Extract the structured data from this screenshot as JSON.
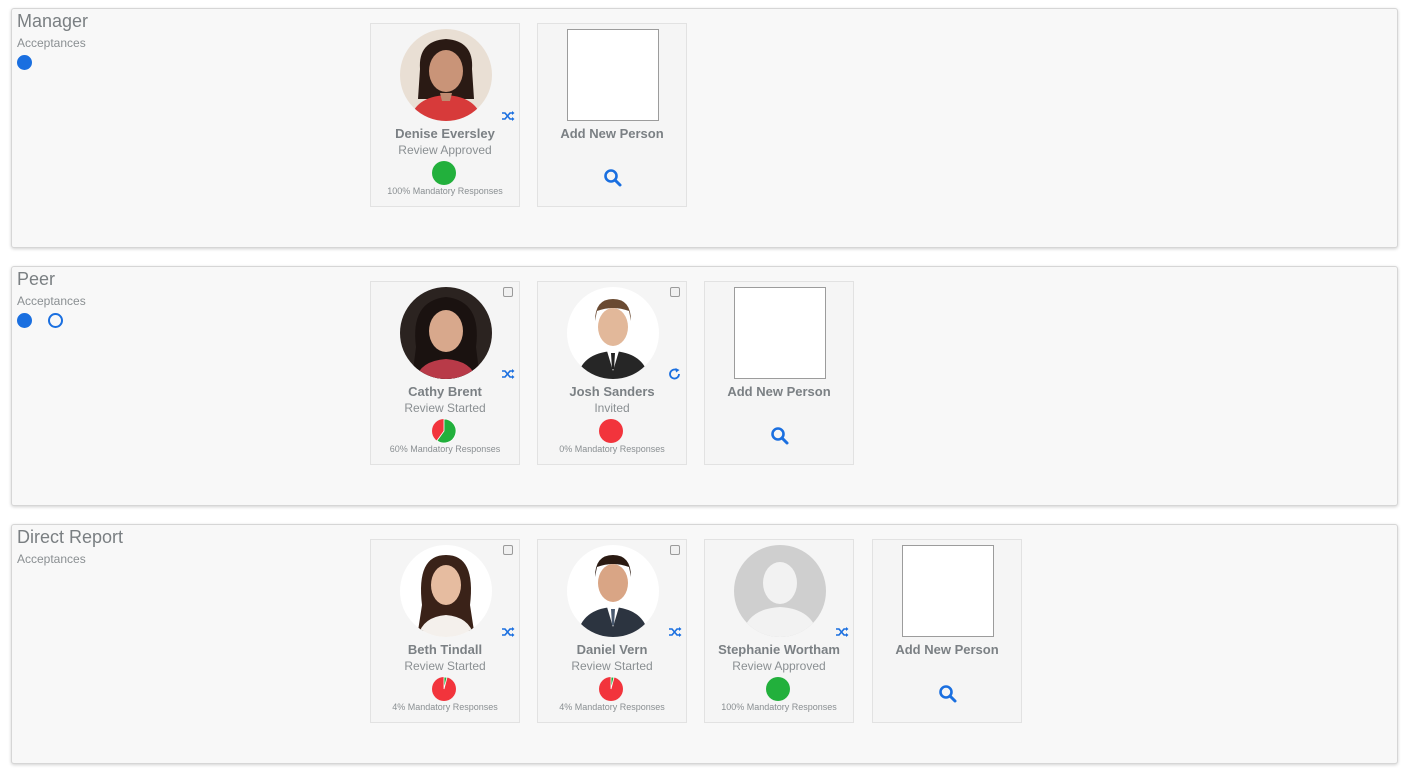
{
  "colors": {
    "accent": "#1a6fe0",
    "green": "#22b03c",
    "red": "#f2343c"
  },
  "sections": [
    {
      "title": "Manager",
      "acceptances_label": "Acceptances",
      "people": [
        {
          "name": "Denise Eversley",
          "status": "Review Approved",
          "responses": "100% Mandatory Responses",
          "progress": 1.0,
          "action_icon": "shuffle-icon",
          "checkbox": false
        }
      ],
      "add_label": "Add New Person"
    },
    {
      "title": "Peer",
      "acceptances_label": "Acceptances",
      "people": [
        {
          "name": "Cathy Brent",
          "status": "Review Started",
          "responses": "60% Mandatory Responses",
          "progress": 0.6,
          "action_icon": "shuffle-icon",
          "checkbox": true
        },
        {
          "name": "Josh Sanders",
          "status": "Invited",
          "responses": "0% Mandatory Responses",
          "progress": 0.0,
          "action_icon": "refresh-icon",
          "checkbox": true
        }
      ],
      "add_label": "Add New Person"
    },
    {
      "title": "Direct Report",
      "acceptances_label": "Acceptances",
      "people": [
        {
          "name": "Beth Tindall",
          "status": "Review Started",
          "responses": "4% Mandatory Responses",
          "progress": 0.04,
          "action_icon": "shuffle-icon",
          "checkbox": true
        },
        {
          "name": "Daniel Vern",
          "status": "Review Started",
          "responses": "4% Mandatory Responses",
          "progress": 0.04,
          "action_icon": "shuffle-icon",
          "checkbox": true
        },
        {
          "name": "Stephanie Wortham",
          "status": "Review Approved",
          "responses": "100% Mandatory Responses",
          "progress": 1.0,
          "action_icon": "shuffle-icon",
          "checkbox": false
        }
      ],
      "add_label": "Add New Person"
    }
  ]
}
